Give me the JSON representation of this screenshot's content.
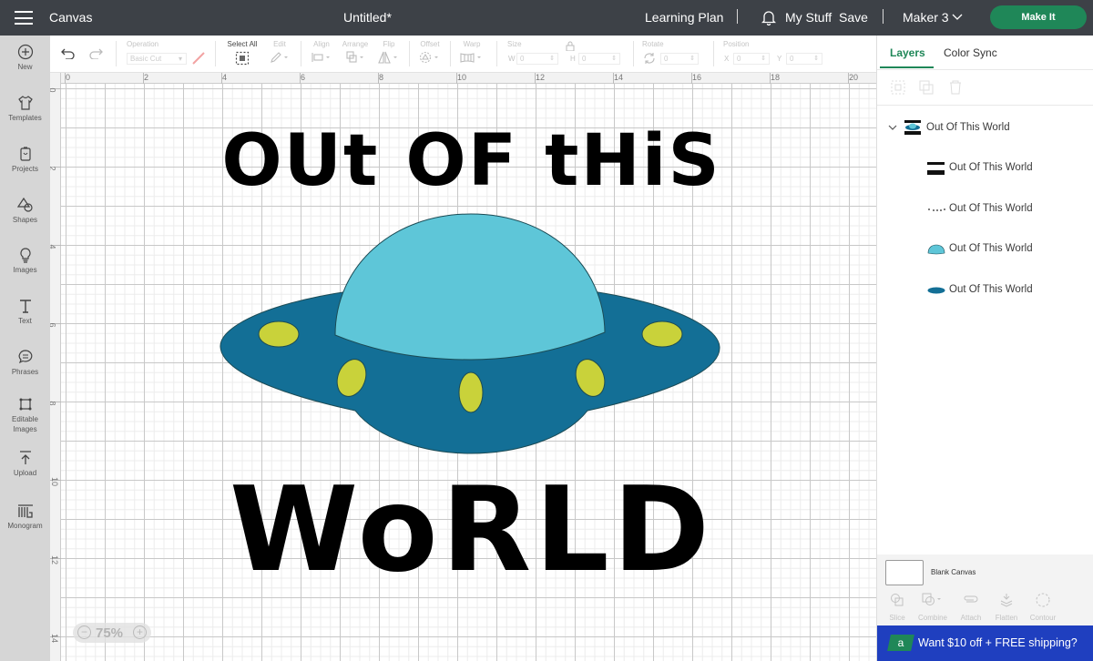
{
  "header": {
    "section": "Canvas",
    "document_title": "Untitled*",
    "learning_plan": "Learning Plan",
    "my_stuff": "My Stuff",
    "save": "Save",
    "machine": "Maker 3",
    "make_it": "Make It",
    "menu_icon": "hamburger-icon",
    "bell_icon": "bell-icon"
  },
  "sidebar": {
    "items": [
      {
        "label": "New",
        "icon": "plus-circle-icon"
      },
      {
        "label": "Templates",
        "icon": "shirt-icon"
      },
      {
        "label": "Projects",
        "icon": "projects-icon"
      },
      {
        "label": "Shapes",
        "icon": "shapes-icon"
      },
      {
        "label": "Images",
        "icon": "lightbulb-icon"
      },
      {
        "label": "Text",
        "icon": "text-icon"
      },
      {
        "label": "Phrases",
        "icon": "speech-bubble-icon"
      },
      {
        "label": "Editable",
        "label2": "Images",
        "icon": "editable-images-icon"
      },
      {
        "label": "Upload",
        "icon": "upload-icon"
      },
      {
        "label": "Monogram",
        "icon": "monogram-icon"
      }
    ]
  },
  "toolbar": {
    "operation_label": "Operation",
    "operation_value": "Basic Cut",
    "select_all": "Select All",
    "edit": "Edit",
    "align": "Align",
    "arrange": "Arrange",
    "flip": "Flip",
    "offset": "Offset",
    "warp": "Warp",
    "size": "Size",
    "w": "W",
    "h": "H",
    "w_value": "0",
    "h_value": "0",
    "rotate": "Rotate",
    "rotate_value": "0",
    "position": "Position",
    "x": "X",
    "y": "Y",
    "x_value": "0",
    "y_value": "0"
  },
  "canvas": {
    "ruler_x": [
      "0",
      "2",
      "4",
      "6",
      "8",
      "10",
      "12",
      "14",
      "16",
      "18",
      "20"
    ],
    "ruler_y": [
      "0",
      "2",
      "4",
      "6",
      "8",
      "10",
      "12",
      "14"
    ],
    "zoom_level": "75%",
    "design": {
      "line1": "OUt OF tHiS",
      "line2": "WoRLD",
      "colors": {
        "text": "#000000",
        "dome": "#5ec6d8",
        "saucer": "#136f96",
        "lights": "#c9d23a",
        "outline": "#1b4b55"
      }
    }
  },
  "panel": {
    "tabs": [
      {
        "label": "Layers",
        "active": true
      },
      {
        "label": "Color Sync",
        "active": false
      }
    ],
    "group": {
      "label": "Out Of This World",
      "expanded": true
    },
    "layers": [
      {
        "label": "Out Of This World",
        "thumb": "text-thumbnail"
      },
      {
        "label": "Out Of This World",
        "thumb": "dots-thumbnail"
      },
      {
        "label": "Out Of This World",
        "thumb": "dome-thumbnail"
      },
      {
        "label": "Out Of This World",
        "thumb": "saucer-thumbnail"
      }
    ],
    "blank_canvas": "Blank Canvas",
    "actions": [
      "Slice",
      "Combine",
      "Attach",
      "Flatten",
      "Contour"
    ],
    "promo": {
      "badge": "a",
      "text": "Want $10 off + FREE shipping?"
    }
  },
  "accent_color": "#1f8758"
}
